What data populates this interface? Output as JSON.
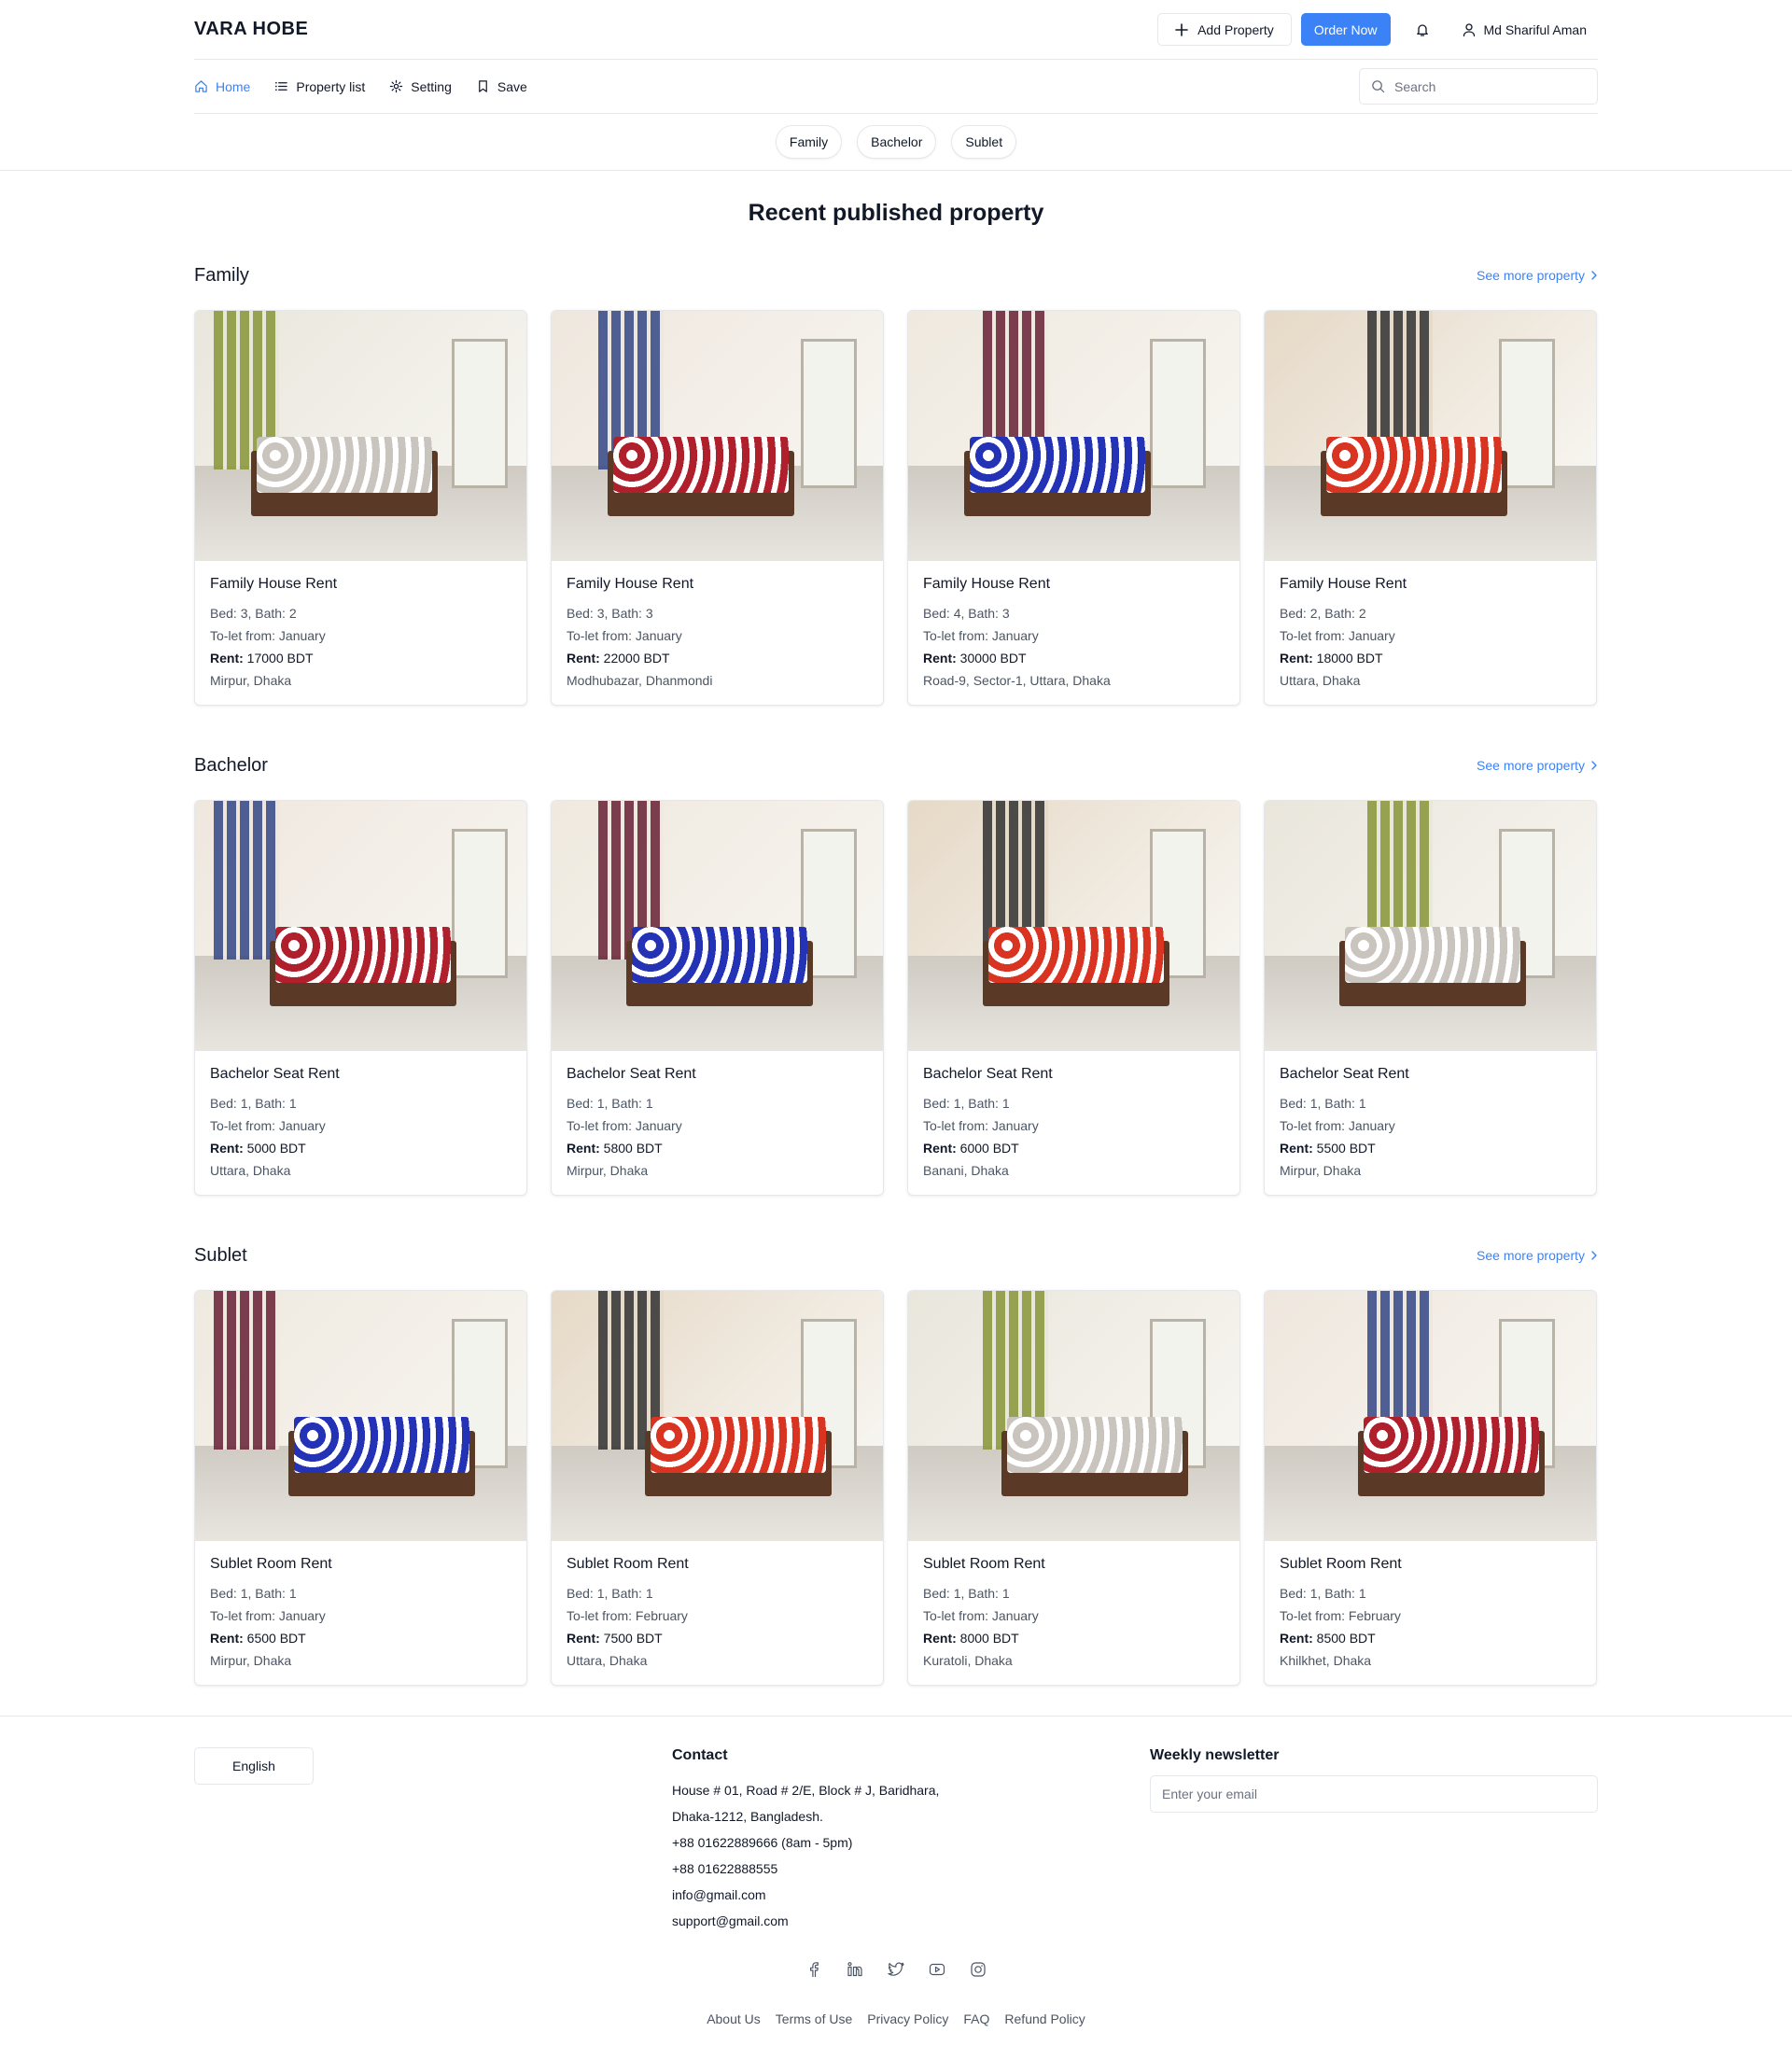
{
  "header": {
    "brand": "VARA HOBE",
    "add_property": "Add Property",
    "order_now": "Order Now",
    "user_name": "Md Shariful Aman",
    "accent": "#3b82f6"
  },
  "nav": {
    "items": [
      {
        "label": "Home",
        "icon": "home-icon"
      },
      {
        "label": "Property list",
        "icon": "list-icon"
      },
      {
        "label": "Setting",
        "icon": "gear-icon"
      },
      {
        "label": "Save",
        "icon": "bookmark-icon"
      }
    ],
    "search_placeholder": "Search"
  },
  "chips": [
    "Family",
    "Bachelor",
    "Sublet"
  ],
  "page_title": "Recent published property",
  "see_more": "See more property",
  "sections": [
    {
      "name": "Family",
      "cards": [
        {
          "title": "Family House Rent",
          "bedbath": "Bed: 3, Bath: 2",
          "tolet": "To-let from: January",
          "rent_label": "Rent:",
          "rent": "17000 BDT",
          "location": "Mirpur, Dhaka"
        },
        {
          "title": "Family House Rent",
          "bedbath": "Bed: 3, Bath: 3",
          "tolet": "To-let from: January",
          "rent_label": "Rent:",
          "rent": "22000 BDT",
          "location": "Modhubazar, Dhanmondi"
        },
        {
          "title": "Family House Rent",
          "bedbath": "Bed: 4, Bath: 3",
          "tolet": "To-let from: January",
          "rent_label": "Rent:",
          "rent": "30000 BDT",
          "location": "Road-9, Sector-1, Uttara, Dhaka"
        },
        {
          "title": "Family House Rent",
          "bedbath": "Bed: 2, Bath: 2",
          "tolet": "To-let from: January",
          "rent_label": "Rent:",
          "rent": "18000 BDT",
          "location": "Uttara, Dhaka"
        }
      ]
    },
    {
      "name": "Bachelor",
      "cards": [
        {
          "title": "Bachelor Seat Rent",
          "bedbath": "Bed: 1, Bath: 1",
          "tolet": "To-let from: January",
          "rent_label": "Rent:",
          "rent": "5000 BDT",
          "location": "Uttara, Dhaka"
        },
        {
          "title": "Bachelor Seat Rent",
          "bedbath": "Bed: 1, Bath: 1",
          "tolet": "To-let from: January",
          "rent_label": "Rent:",
          "rent": "5800 BDT",
          "location": "Mirpur, Dhaka"
        },
        {
          "title": "Bachelor Seat Rent",
          "bedbath": "Bed: 1, Bath: 1",
          "tolet": "To-let from: January",
          "rent_label": "Rent:",
          "rent": "6000 BDT",
          "location": "Banani, Dhaka"
        },
        {
          "title": "Bachelor Seat Rent",
          "bedbath": "Bed: 1, Bath: 1",
          "tolet": "To-let from: January",
          "rent_label": "Rent:",
          "rent": "5500 BDT",
          "location": "Mirpur, Dhaka"
        }
      ]
    },
    {
      "name": "Sublet",
      "cards": [
        {
          "title": "Sublet Room Rent",
          "bedbath": "Bed: 1, Bath: 1",
          "tolet": "To-let from: January",
          "rent_label": "Rent:",
          "rent": "6500 BDT",
          "location": "Mirpur, Dhaka"
        },
        {
          "title": "Sublet Room Rent",
          "bedbath": "Bed: 1, Bath: 1",
          "tolet": "To-let from: February",
          "rent_label": "Rent:",
          "rent": "7500 BDT",
          "location": "Uttara, Dhaka"
        },
        {
          "title": "Sublet Room Rent",
          "bedbath": "Bed: 1, Bath: 1",
          "tolet": "To-let from: January",
          "rent_label": "Rent:",
          "rent": "8000 BDT",
          "location": "Kuratoli, Dhaka"
        },
        {
          "title": "Sublet Room Rent",
          "bedbath": "Bed: 1, Bath: 1",
          "tolet": "To-let from: February",
          "rent_label": "Rent:",
          "rent": "8500 BDT",
          "location": "Khilkhet, Dhaka"
        }
      ]
    }
  ],
  "footer": {
    "language": "English",
    "contact_title": "Contact",
    "contact_lines": [
      "House # 01, Road # 2/E, Block # J, Baridhara,",
      "Dhaka-1212, Bangladesh.",
      "+88 01622889666 (8am - 5pm)",
      "+88 01622888555",
      "info@gmail.com",
      "support@gmail.com"
    ],
    "newsletter_title": "Weekly newsletter",
    "newsletter_placeholder": "Enter your email",
    "socials": [
      "facebook-icon",
      "linkedin-icon",
      "twitter-icon",
      "youtube-icon",
      "instagram-icon"
    ],
    "links": [
      "About Us",
      "Terms of Use",
      "Privacy Policy",
      "FAQ",
      "Refund Policy"
    ]
  }
}
